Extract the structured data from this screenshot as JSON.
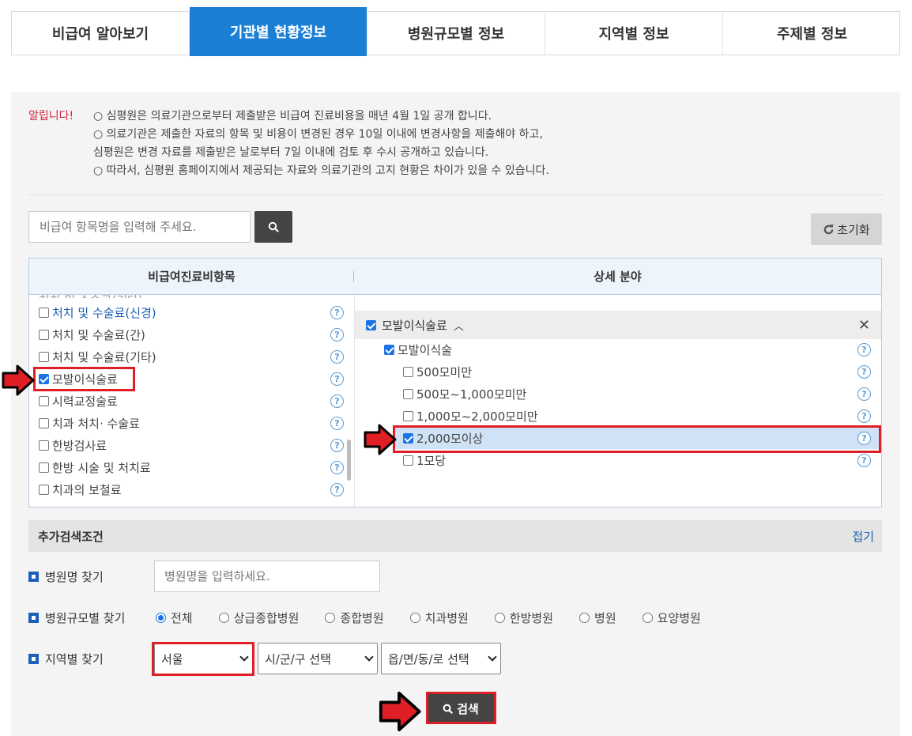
{
  "tabs": [
    "비급여 알아보기",
    "기관별 현황정보",
    "병원규모별 정보",
    "지역별 정보",
    "주제별 정보"
  ],
  "active_tab_index": 1,
  "notice": {
    "label": "알립니다!",
    "lines": [
      "○ 심평원은 의료기관으로부터 제출받은 비급여 진료비용을 매년 4월 1일 공개 합니다.",
      "○ 의료기관은 제출한 자료의 항목 및 비용이 변경된 경우 10일 이내에 변경사항을 제출해야 하고,",
      "심평원은 변경 자료를 제출받은 날로부터 7일 이내에 검토 후 수시 공개하고 있습니다.",
      "○ 따라서, 심평원 홈페이지에서 제공되는 자료와 의료기관의 고지 현황은 차이가 있을 수 있습니다."
    ]
  },
  "search": {
    "placeholder": "비급여 항목명을 입력해 주세요."
  },
  "reset_label": "초기화",
  "columns": {
    "left": "비급여진료비항목",
    "right": "상세 분야"
  },
  "left_items": [
    {
      "label": "처치 및 수술료(신경)",
      "checked": false,
      "link": true
    },
    {
      "label": "처치 및 수술료(간)",
      "checked": false
    },
    {
      "label": "처치 및 수술료(기타)",
      "checked": false
    },
    {
      "label": "모발이식술료",
      "checked": true
    },
    {
      "label": "시력교정술료",
      "checked": false
    },
    {
      "label": "치과 처치· 수술료",
      "checked": false
    },
    {
      "label": "한방검사료",
      "checked": false
    },
    {
      "label": "한방 시술 및 처치료",
      "checked": false
    },
    {
      "label": "치과의 보철료",
      "checked": false
    }
  ],
  "detail": {
    "group": "모발이식술료",
    "sub": "모발이식술",
    "options": [
      {
        "label": "500모미만",
        "checked": false
      },
      {
        "label": "500모~1,000모미만",
        "checked": false
      },
      {
        "label": "1,000모~2,000모미만",
        "checked": false
      },
      {
        "label": "2,000모이상",
        "checked": true
      },
      {
        "label": "1모당",
        "checked": false
      }
    ]
  },
  "extra": {
    "title": "추가검색조건",
    "fold_label": "접기",
    "hospital_name_label": "병원명 찾기",
    "hospital_name_placeholder": "병원명을 입력하세요.",
    "scale_label": "병원규모별 찾기",
    "scale_options": [
      "전체",
      "상급종합병원",
      "종합병원",
      "치과병원",
      "한방병원",
      "병원",
      "요양병원"
    ],
    "scale_selected": 0,
    "region_label": "지역별 찾기",
    "region_selects": [
      "서울",
      "시/군/구 선택",
      "읍/면/동/로 선택"
    ]
  },
  "search_button_label": "검색",
  "colors": {
    "tab_active": "#1c7fd6",
    "highlight": "#e01e26",
    "alert": "#d0243e"
  }
}
